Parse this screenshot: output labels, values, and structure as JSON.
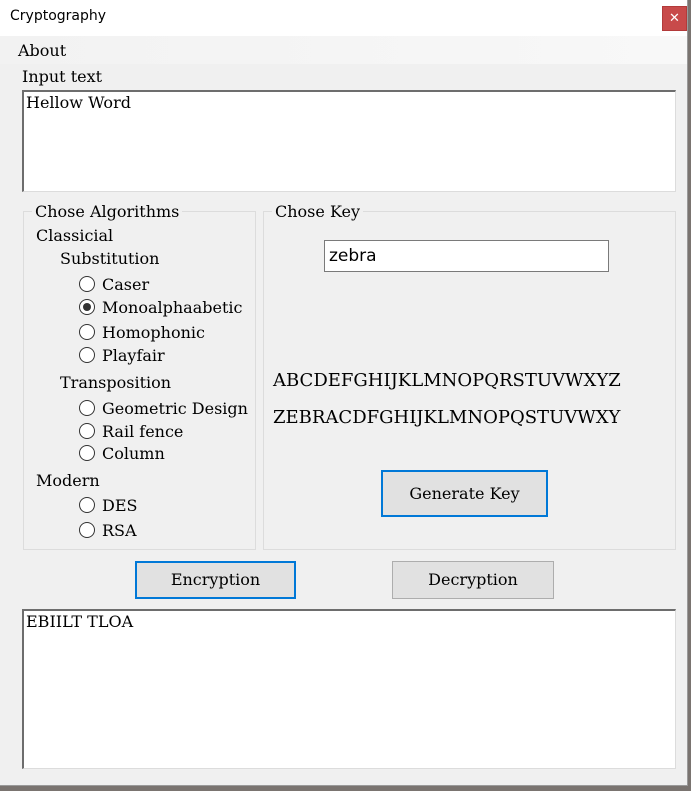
{
  "window": {
    "title": "Cryptography",
    "close_glyph": "✕"
  },
  "menu": {
    "about": "About"
  },
  "input": {
    "label": "Input text",
    "value": "Hellow Word"
  },
  "algorithms": {
    "title": "Chose Algorithms",
    "classical_label": "Classicial",
    "substitution_label": "Substitution",
    "transposition_label": "Transposition",
    "modern_label": "Modern",
    "substitution_options": [
      "Caser",
      "Monoalphaabetic",
      "Homophonic",
      "Playfair"
    ],
    "transposition_options": [
      "Geometric Design",
      "Rail fence",
      "Column"
    ],
    "modern_options": [
      "DES",
      "RSA"
    ],
    "selected": "Monoalphaabetic"
  },
  "key": {
    "title": "Chose Key",
    "value": "zebra",
    "plain_alphabet": "ABCDEFGHIJKLMNOPQRSTUVWXYZ",
    "cipher_alphabet": "ZEBRACDFGHIJKLMNOPQSTUVWXY",
    "generate_label": "Generate Key"
  },
  "actions": {
    "encrypt_label": "Encryption",
    "decrypt_label": "Decryption"
  },
  "output": {
    "value": "EBIILT TLOA"
  },
  "colors": {
    "accent": "#0078d7",
    "close": "#c84a4a"
  }
}
